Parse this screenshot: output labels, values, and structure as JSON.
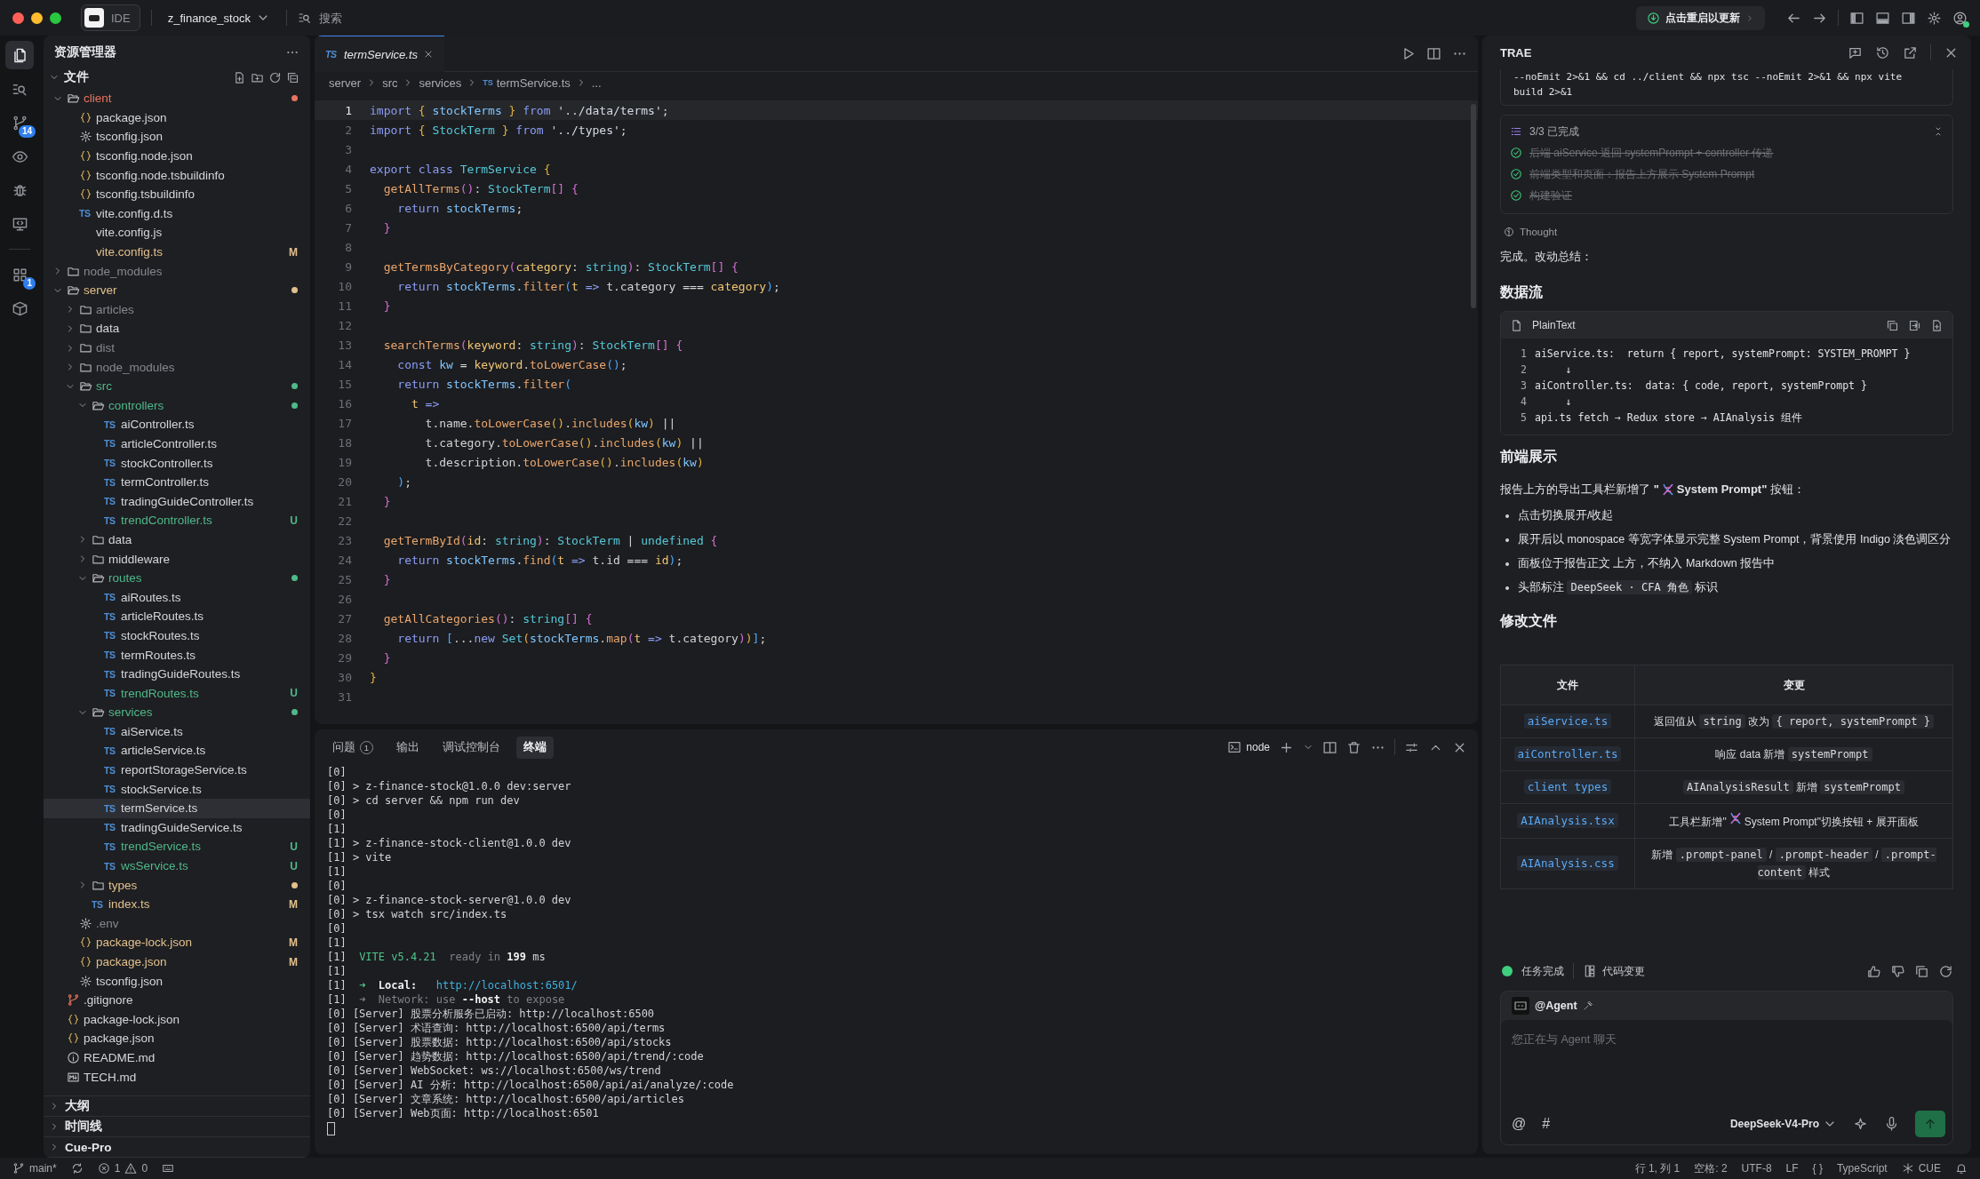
{
  "title_bar": {
    "app_label": "IDE",
    "project": "z_finance_stock",
    "search_placeholder": "搜索",
    "update_button": "点击重启以更新"
  },
  "activity_bar": [
    {
      "selected": true
    },
    {
      "selected": false
    },
    {
      "selected": false,
      "badge": "14"
    },
    {
      "selected": false
    },
    {
      "selected": false
    },
    {
      "selected": false
    },
    {
      "selected": false,
      "badge": "1"
    },
    {
      "selected": false
    }
  ],
  "explorer": {
    "title": "资源管理器",
    "section": "文件",
    "tree": [
      {
        "name": "client",
        "kind": "folder",
        "color": "#e8735f",
        "dot": true,
        "expanded": true,
        "selected": false,
        "children": [
          {
            "name": "package.json",
            "kind": "json",
            "color": "#d4d6da",
            "selected": false
          },
          {
            "name": "tsconfig.json",
            "kind": "gear",
            "color": "#d4d6da",
            "selected": false
          },
          {
            "name": "tsconfig.node.json",
            "kind": "json",
            "color": "#d4d6da",
            "selected": false
          },
          {
            "name": "tsconfig.node.tsbuildinfo",
            "kind": "json",
            "color": "#d4d6da",
            "selected": false
          },
          {
            "name": "tsconfig.tsbuildinfo",
            "kind": "json",
            "color": "#d4d6da",
            "selected": false
          },
          {
            "name": "vite.config.d.ts",
            "kind": "ts",
            "icon_label": "TS",
            "color": "#d4d6da",
            "selected": false
          },
          {
            "name": "vite.config.js",
            "kind": "plain",
            "color": "#d4d6da",
            "selected": false
          },
          {
            "name": "vite.config.ts",
            "kind": "plain",
            "color": "#e2c08d",
            "badge": "M",
            "selected": false
          }
        ]
      },
      {
        "name": "node_modules",
        "kind": "folder",
        "color": "#85888f",
        "dot": false,
        "expanded": false,
        "selected": false
      },
      {
        "name": "server",
        "kind": "folder",
        "color": "#e2c08d",
        "dot": true,
        "expanded": true,
        "selected": false,
        "children": [
          {
            "name": "articles",
            "kind": "folder",
            "color": "#85888f",
            "dot": false,
            "expanded": false,
            "selected": false
          },
          {
            "name": "data",
            "kind": "folder",
            "color": "#d4d6da",
            "dot": false,
            "expanded": false,
            "selected": false
          },
          {
            "name": "dist",
            "kind": "folder",
            "color": "#85888f",
            "dot": false,
            "expanded": false,
            "selected": false
          },
          {
            "name": "node_modules",
            "kind": "folder",
            "color": "#85888f",
            "dot": false,
            "expanded": false,
            "selected": false
          },
          {
            "name": "src",
            "kind": "folder",
            "color": "#4fb98a",
            "dot": true,
            "expanded": true,
            "selected": false,
            "children": [
              {
                "name": "controllers",
                "kind": "folder",
                "color": "#4fb98a",
                "dot": true,
                "expanded": true,
                "selected": false,
                "children": [
                  {
                    "name": "aiController.ts",
                    "kind": "ts",
                    "icon_label": "TS",
                    "color": "#d4d6da",
                    "selected": false
                  },
                  {
                    "name": "articleController.ts",
                    "kind": "ts",
                    "icon_label": "TS",
                    "color": "#d4d6da",
                    "selected": false
                  },
                  {
                    "name": "stockController.ts",
                    "kind": "ts",
                    "icon_label": "TS",
                    "color": "#d4d6da",
                    "selected": false
                  },
                  {
                    "name": "termController.ts",
                    "kind": "ts",
                    "icon_label": "TS",
                    "color": "#d4d6da",
                    "selected": false
                  },
                  {
                    "name": "tradingGuideController.ts",
                    "kind": "ts",
                    "icon_label": "TS",
                    "color": "#d4d6da",
                    "selected": false
                  },
                  {
                    "name": "trendController.ts",
                    "kind": "ts",
                    "icon_label": "TS",
                    "color": "#4fb98a",
                    "badge": "U",
                    "selected": false
                  }
                ]
              },
              {
                "name": "data",
                "kind": "folder",
                "color": "#d4d6da",
                "dot": false,
                "expanded": false,
                "selected": false
              },
              {
                "name": "middleware",
                "kind": "folder",
                "color": "#d4d6da",
                "dot": false,
                "expanded": false,
                "selected": false
              },
              {
                "name": "routes",
                "kind": "folder",
                "color": "#4fb98a",
                "dot": true,
                "expanded": true,
                "selected": false,
                "children": [
                  {
                    "name": "aiRoutes.ts",
                    "kind": "ts",
                    "icon_label": "TS",
                    "color": "#d4d6da",
                    "selected": false
                  },
                  {
                    "name": "articleRoutes.ts",
                    "kind": "ts",
                    "icon_label": "TS",
                    "color": "#d4d6da",
                    "selected": false
                  },
                  {
                    "name": "stockRoutes.ts",
                    "kind": "ts",
                    "icon_label": "TS",
                    "color": "#d4d6da",
                    "selected": false
                  },
                  {
                    "name": "termRoutes.ts",
                    "kind": "ts",
                    "icon_label": "TS",
                    "color": "#d4d6da",
                    "selected": false
                  },
                  {
                    "name": "tradingGuideRoutes.ts",
                    "kind": "ts",
                    "icon_label": "TS",
                    "color": "#d4d6da",
                    "selected": false
                  },
                  {
                    "name": "trendRoutes.ts",
                    "kind": "ts",
                    "icon_label": "TS",
                    "color": "#4fb98a",
                    "badge": "U",
                    "selected": false
                  }
                ]
              },
              {
                "name": "services",
                "kind": "folder",
                "color": "#4fb98a",
                "dot": true,
                "expanded": true,
                "selected": false,
                "children": [
                  {
                    "name": "aiService.ts",
                    "kind": "ts",
                    "icon_label": "TS",
                    "color": "#d4d6da",
                    "selected": false
                  },
                  {
                    "name": "articleService.ts",
                    "kind": "ts",
                    "icon_label": "TS",
                    "color": "#d4d6da",
                    "selected": false
                  },
                  {
                    "name": "reportStorageService.ts",
                    "kind": "ts",
                    "icon_label": "TS",
                    "color": "#d4d6da",
                    "selected": false
                  },
                  {
                    "name": "stockService.ts",
                    "kind": "ts",
                    "icon_label": "TS",
                    "color": "#d4d6da",
                    "selected": false
                  },
                  {
                    "name": "termService.ts",
                    "kind": "ts",
                    "icon_label": "TS",
                    "color": "#d4d6da",
                    "selected": true
                  },
                  {
                    "name": "tradingGuideService.ts",
                    "kind": "ts",
                    "icon_label": "TS",
                    "color": "#d4d6da",
                    "selected": false
                  },
                  {
                    "name": "trendService.ts",
                    "kind": "ts",
                    "icon_label": "TS",
                    "color": "#4fb98a",
                    "badge": "U",
                    "selected": false
                  },
                  {
                    "name": "wsService.ts",
                    "kind": "ts",
                    "icon_label": "TS",
                    "color": "#4fb98a",
                    "badge": "U",
                    "selected": false
                  }
                ]
              },
              {
                "name": "types",
                "kind": "folder",
                "color": "#e2c08d",
                "dot": true,
                "expanded": false,
                "selected": false
              },
              {
                "name": "index.ts",
                "kind": "ts",
                "icon_label": "TS",
                "color": "#e2c08d",
                "badge": "M",
                "selected": false
              }
            ]
          },
          {
            "name": ".env",
            "kind": "gear",
            "color": "#85888f",
            "selected": false
          },
          {
            "name": "package-lock.json",
            "kind": "json",
            "color": "#e2c08d",
            "badge": "M",
            "selected": false
          },
          {
            "name": "package.json",
            "kind": "json",
            "color": "#e2c08d",
            "badge": "M",
            "selected": false
          },
          {
            "name": "tsconfig.json",
            "kind": "gear",
            "color": "#d4d6da",
            "selected": false
          }
        ]
      },
      {
        "name": ".gitignore",
        "kind": "git",
        "color": "#d4d6da",
        "selected": false
      },
      {
        "name": "package-lock.json",
        "kind": "json",
        "color": "#d4d6da",
        "selected": false
      },
      {
        "name": "package.json",
        "kind": "json",
        "color": "#d4d6da",
        "selected": false
      },
      {
        "name": "README.md",
        "kind": "info",
        "color": "#d4d6da",
        "selected": false
      },
      {
        "name": "TECH.md",
        "kind": "md",
        "color": "#d4d6da",
        "selected": false
      }
    ],
    "panels": [
      "大纲",
      "时间线",
      "Cue-Pro"
    ]
  },
  "editor": {
    "tabs": [
      {
        "label": "termService.ts",
        "icon_label": "TS",
        "selected": true
      }
    ],
    "breadcrumb": [
      {
        "label": "server"
      },
      {
        "label": "src"
      },
      {
        "label": "services"
      },
      {
        "label": "termService.ts",
        "icon_label": "TS"
      },
      {
        "label": "..."
      }
    ],
    "lines": [
      {
        "number": "1",
        "current": true,
        "tokens": [
          {
            "text": "import",
            "kind": "keyword"
          },
          {
            "text": " {",
            "kind": "brace"
          },
          {
            "text": " stockTerms ",
            "kind": "variable"
          },
          {
            "text": "}",
            "kind": "brace"
          },
          {
            "text": " from",
            "kind": "keyword"
          },
          {
            "text": " '../data/terms'",
            "kind": "string"
          },
          {
            "text": ";",
            "kind": "plain"
          }
        ]
      },
      {
        "number": "2",
        "current": false,
        "tokens": [
          {
            "text": "import",
            "kind": "keyword"
          },
          {
            "text": " {",
            "kind": "brace"
          },
          {
            "text": " StockTerm ",
            "kind": "type"
          },
          {
            "text": "}",
            "kind": "brace"
          },
          {
            "text": " from",
            "kind": "keyword"
          },
          {
            "text": " '../types'",
            "kind": "string"
          },
          {
            "text": ";",
            "kind": "plain"
          }
        ]
      },
      {
        "number": "3",
        "current": false
      },
      {
        "number": "4",
        "current": false,
        "tokens": [
          {
            "text": "export class",
            "kind": "keyword"
          },
          {
            "text": " TermService",
            "kind": "type"
          },
          {
            "text": " {",
            "kind": "brace"
          }
        ]
      },
      {
        "number": "5",
        "current": false,
        "tokens": [
          {
            "text": "  getAllTerms",
            "kind": "function"
          },
          {
            "text": "()",
            "kind": "paren"
          },
          {
            "text": ": ",
            "kind": "plain"
          },
          {
            "text": "StockTerm",
            "kind": "type"
          },
          {
            "text": "[]",
            "kind": "paren"
          },
          {
            "text": " {",
            "kind": "paren"
          }
        ]
      },
      {
        "number": "6",
        "current": false,
        "tokens": [
          {
            "text": "    return",
            "kind": "keyword"
          },
          {
            "text": " stockTerms",
            "kind": "variable"
          },
          {
            "text": ";",
            "kind": "plain"
          }
        ]
      },
      {
        "number": "7",
        "current": false,
        "tokens": [
          {
            "text": "  }",
            "kind": "paren"
          }
        ]
      },
      {
        "number": "8",
        "current": false
      },
      {
        "number": "9",
        "current": false,
        "tokens": [
          {
            "text": "  getTermsByCategory",
            "kind": "function"
          },
          {
            "text": "(",
            "kind": "paren"
          },
          {
            "text": "category",
            "kind": "parameter"
          },
          {
            "text": ": ",
            "kind": "plain"
          },
          {
            "text": "string",
            "kind": "type"
          },
          {
            "text": ")",
            "kind": "paren"
          },
          {
            "text": ": ",
            "kind": "plain"
          },
          {
            "text": "StockTerm",
            "kind": "type"
          },
          {
            "text": "[]",
            "kind": "paren"
          },
          {
            "text": " {",
            "kind": "paren"
          }
        ]
      },
      {
        "number": "10",
        "current": false,
        "tokens": [
          {
            "text": "    return",
            "kind": "keyword"
          },
          {
            "text": " stockTerms",
            "kind": "variable"
          },
          {
            "text": ".",
            "kind": "plain"
          },
          {
            "text": "filter",
            "kind": "function"
          },
          {
            "text": "(",
            "kind": "bracket"
          },
          {
            "text": "t",
            "kind": "parameter"
          },
          {
            "text": " => ",
            "kind": "keyword"
          },
          {
            "text": "t.category === ",
            "kind": "plain"
          },
          {
            "text": "category",
            "kind": "parameter"
          },
          {
            "text": ")",
            "kind": "bracket"
          },
          {
            "text": ";",
            "kind": "plain"
          }
        ]
      },
      {
        "number": "11",
        "current": false,
        "tokens": [
          {
            "text": "  }",
            "kind": "paren"
          }
        ]
      },
      {
        "number": "12",
        "current": false
      },
      {
        "number": "13",
        "current": false,
        "tokens": [
          {
            "text": "  searchTerms",
            "kind": "function"
          },
          {
            "text": "(",
            "kind": "paren"
          },
          {
            "text": "keyword",
            "kind": "parameter"
          },
          {
            "text": ": ",
            "kind": "plain"
          },
          {
            "text": "string",
            "kind": "type"
          },
          {
            "text": ")",
            "kind": "paren"
          },
          {
            "text": ": ",
            "kind": "plain"
          },
          {
            "text": "StockTerm",
            "kind": "type"
          },
          {
            "text": "[]",
            "kind": "paren"
          },
          {
            "text": " {",
            "kind": "paren"
          }
        ]
      },
      {
        "number": "14",
        "current": false,
        "tokens": [
          {
            "text": "    const",
            "kind": "keyword"
          },
          {
            "text": " kw",
            "kind": "variable"
          },
          {
            "text": " = ",
            "kind": "plain"
          },
          {
            "text": "keyword",
            "kind": "parameter"
          },
          {
            "text": ".",
            "kind": "plain"
          },
          {
            "text": "toLowerCase",
            "kind": "function"
          },
          {
            "text": "()",
            "kind": "bracket"
          },
          {
            "text": ";",
            "kind": "plain"
          }
        ]
      },
      {
        "number": "15",
        "current": false,
        "tokens": [
          {
            "text": "    return",
            "kind": "keyword"
          },
          {
            "text": " stockTerms",
            "kind": "variable"
          },
          {
            "text": ".",
            "kind": "plain"
          },
          {
            "text": "filter",
            "kind": "function"
          },
          {
            "text": "(",
            "kind": "bracket"
          }
        ]
      },
      {
        "number": "16",
        "current": false,
        "tokens": [
          {
            "text": "      t",
            "kind": "parameter"
          },
          {
            "text": " =>",
            "kind": "keyword"
          }
        ]
      },
      {
        "number": "17",
        "current": false,
        "tokens": [
          {
            "text": "        t.name.",
            "kind": "plain"
          },
          {
            "text": "toLowerCase",
            "kind": "function"
          },
          {
            "text": "()",
            "kind": "brace"
          },
          {
            "text": ".",
            "kind": "plain"
          },
          {
            "text": "includes",
            "kind": "function"
          },
          {
            "text": "(",
            "kind": "brace"
          },
          {
            "text": "kw",
            "kind": "variable"
          },
          {
            "text": ")",
            "kind": "brace"
          },
          {
            "text": " ||",
            "kind": "plain"
          }
        ]
      },
      {
        "number": "18",
        "current": false,
        "tokens": [
          {
            "text": "        t.category.",
            "kind": "plain"
          },
          {
            "text": "toLowerCase",
            "kind": "function"
          },
          {
            "text": "()",
            "kind": "brace"
          },
          {
            "text": ".",
            "kind": "plain"
          },
          {
            "text": "includes",
            "kind": "function"
          },
          {
            "text": "(",
            "kind": "brace"
          },
          {
            "text": "kw",
            "kind": "variable"
          },
          {
            "text": ")",
            "kind": "brace"
          },
          {
            "text": " ||",
            "kind": "plain"
          }
        ]
      },
      {
        "number": "19",
        "current": false,
        "tokens": [
          {
            "text": "        t.description.",
            "kind": "plain"
          },
          {
            "text": "toLowerCase",
            "kind": "function"
          },
          {
            "text": "()",
            "kind": "brace"
          },
          {
            "text": ".",
            "kind": "plain"
          },
          {
            "text": "includes",
            "kind": "function"
          },
          {
            "text": "(",
            "kind": "brace"
          },
          {
            "text": "kw",
            "kind": "variable"
          },
          {
            "text": ")",
            "kind": "brace"
          }
        ]
      },
      {
        "number": "20",
        "current": false,
        "tokens": [
          {
            "text": "    )",
            "kind": "bracket"
          },
          {
            "text": ";",
            "kind": "plain"
          }
        ]
      },
      {
        "number": "21",
        "current": false,
        "tokens": [
          {
            "text": "  }",
            "kind": "paren"
          }
        ]
      },
      {
        "number": "22",
        "current": false
      },
      {
        "number": "23",
        "current": false,
        "tokens": [
          {
            "text": "  getTermById",
            "kind": "function"
          },
          {
            "text": "(",
            "kind": "paren"
          },
          {
            "text": "id",
            "kind": "parameter"
          },
          {
            "text": ": ",
            "kind": "plain"
          },
          {
            "text": "string",
            "kind": "type"
          },
          {
            "text": ")",
            "kind": "paren"
          },
          {
            "text": ": ",
            "kind": "plain"
          },
          {
            "text": "StockTerm",
            "kind": "type"
          },
          {
            "text": " | ",
            "kind": "plain"
          },
          {
            "text": "undefined",
            "kind": "type"
          },
          {
            "text": " {",
            "kind": "paren"
          }
        ]
      },
      {
        "number": "24",
        "current": false,
        "tokens": [
          {
            "text": "    return",
            "kind": "keyword"
          },
          {
            "text": " stockTerms",
            "kind": "variable"
          },
          {
            "text": ".",
            "kind": "plain"
          },
          {
            "text": "find",
            "kind": "function"
          },
          {
            "text": "(",
            "kind": "bracket"
          },
          {
            "text": "t",
            "kind": "parameter"
          },
          {
            "text": " => ",
            "kind": "keyword"
          },
          {
            "text": "t.id === ",
            "kind": "plain"
          },
          {
            "text": "id",
            "kind": "parameter"
          },
          {
            "text": ")",
            "kind": "bracket"
          },
          {
            "text": ";",
            "kind": "plain"
          }
        ]
      },
      {
        "number": "25",
        "current": false,
        "tokens": [
          {
            "text": "  }",
            "kind": "paren"
          }
        ]
      },
      {
        "number": "26",
        "current": false
      },
      {
        "number": "27",
        "current": false,
        "tokens": [
          {
            "text": "  getAllCategories",
            "kind": "function"
          },
          {
            "text": "()",
            "kind": "paren"
          },
          {
            "text": ": ",
            "kind": "plain"
          },
          {
            "text": "string",
            "kind": "type"
          },
          {
            "text": "[]",
            "kind": "paren"
          },
          {
            "text": " {",
            "kind": "paren"
          }
        ]
      },
      {
        "number": "28",
        "current": false,
        "tokens": [
          {
            "text": "    return",
            "kind": "keyword"
          },
          {
            "text": " [",
            "kind": "bracket"
          },
          {
            "text": "...",
            "kind": "plain"
          },
          {
            "text": "new",
            "kind": "keyword"
          },
          {
            "text": " Set",
            "kind": "type"
          },
          {
            "text": "(",
            "kind": "brace"
          },
          {
            "text": "stockTerms",
            "kind": "variable"
          },
          {
            "text": ".",
            "kind": "plain"
          },
          {
            "text": "map",
            "kind": "function"
          },
          {
            "text": "(",
            "kind": "paren"
          },
          {
            "text": "t",
            "kind": "parameter"
          },
          {
            "text": " => ",
            "kind": "keyword"
          },
          {
            "text": "t.category",
            "kind": "plain"
          },
          {
            "text": ")",
            "kind": "paren"
          },
          {
            "text": ")",
            "kind": "brace"
          },
          {
            "text": "]",
            "kind": "bracket"
          },
          {
            "text": ";",
            "kind": "plain"
          }
        ]
      },
      {
        "number": "29",
        "current": false,
        "tokens": [
          {
            "text": "  }",
            "kind": "paren"
          }
        ]
      },
      {
        "number": "30",
        "current": false,
        "tokens": [
          {
            "text": "}",
            "kind": "brace"
          }
        ]
      },
      {
        "number": "31",
        "current": false
      }
    ]
  },
  "panel": {
    "tabs": [
      {
        "label": "问题",
        "badge": "1",
        "selected": false
      },
      {
        "label": "输出",
        "selected": false
      },
      {
        "label": "调试控制台",
        "selected": false
      },
      {
        "label": "终端",
        "selected": true
      }
    ],
    "shell": "node",
    "lines": [
      {
        "segments": [
          {
            "text": "[0]",
            "kind": "plain"
          }
        ]
      },
      {
        "segments": [
          {
            "text": "[0] > z-finance-stock@1.0.0 dev:server",
            "kind": "plain"
          }
        ]
      },
      {
        "segments": [
          {
            "text": "[0] > cd server && npm run dev",
            "kind": "plain"
          }
        ]
      },
      {
        "segments": [
          {
            "text": "[0]",
            "kind": "plain"
          }
        ]
      },
      {
        "segments": [
          {
            "text": "[1]",
            "kind": "plain"
          }
        ]
      },
      {
        "segments": [
          {
            "text": "[1] > z-finance-stock-client@1.0.0 dev",
            "kind": "plain"
          }
        ]
      },
      {
        "segments": [
          {
            "text": "[1] > vite",
            "kind": "plain"
          }
        ]
      },
      {
        "segments": [
          {
            "text": "[1]",
            "kind": "plain"
          }
        ]
      },
      {
        "segments": [
          {
            "text": "[0]",
            "kind": "plain"
          }
        ]
      },
      {
        "segments": [
          {
            "text": "[0] > z-finance-stock-server@1.0.0 dev",
            "kind": "plain"
          }
        ]
      },
      {
        "segments": [
          {
            "text": "[0] > tsx watch src/index.ts",
            "kind": "plain"
          }
        ]
      },
      {
        "segments": [
          {
            "text": "[0]",
            "kind": "plain"
          }
        ]
      },
      {
        "segments": [
          {
            "text": "[1]",
            "kind": "plain"
          }
        ]
      },
      {
        "segments": [
          {
            "text": "[1]  ",
            "kind": "plain"
          },
          {
            "text": "VITE v5.4.21",
            "kind": "accent"
          },
          {
            "text": "  ready in ",
            "kind": "muted"
          },
          {
            "text": "199",
            "kind": "strong"
          },
          {
            "text": " ms",
            "kind": "plain"
          }
        ]
      },
      {
        "segments": [
          {
            "text": "[1]",
            "kind": "plain"
          }
        ]
      },
      {
        "segments": [
          {
            "text": "[1]  ",
            "kind": "plain"
          },
          {
            "text": "➜",
            "kind": "accent"
          },
          {
            "text": "  Local:   ",
            "kind": "strong"
          },
          {
            "text": "http://localhost:6501/",
            "kind": "link"
          }
        ]
      },
      {
        "segments": [
          {
            "text": "[1]  ",
            "kind": "plain"
          },
          {
            "text": "➜  Network: use ",
            "kind": "muted"
          },
          {
            "text": "--host",
            "kind": "strong"
          },
          {
            "text": " to expose",
            "kind": "muted"
          }
        ]
      },
      {
        "segments": [
          {
            "text": "[0] [Server] 股票分析服务已启动: http://localhost:6500",
            "kind": "plain"
          }
        ]
      },
      {
        "segments": [
          {
            "text": "[0] [Server] 术语查询: http://localhost:6500/api/terms",
            "kind": "plain"
          }
        ]
      },
      {
        "segments": [
          {
            "text": "[0] [Server] 股票数据: http://localhost:6500/api/stocks",
            "kind": "plain"
          }
        ]
      },
      {
        "segments": [
          {
            "text": "[0] [Server] 趋势数据: http://localhost:6500/api/trend/:code",
            "kind": "plain"
          }
        ]
      },
      {
        "segments": [
          {
            "text": "[0] [Server] WebSocket: ws://localhost:6500/ws/trend",
            "kind": "plain"
          }
        ]
      },
      {
        "segments": [
          {
            "text": "[0] [Server] AI 分析: http://localhost:6500/api/ai/analyze/:code",
            "kind": "plain"
          }
        ]
      },
      {
        "segments": [
          {
            "text": "[0] [Server] 文章系统: http://localhost:6500/api/articles",
            "kind": "plain"
          }
        ]
      },
      {
        "segments": [
          {
            "text": "[0] [Server] Web页面: http://localhost:6501",
            "kind": "plain"
          }
        ]
      }
    ]
  },
  "assistant": {
    "title": "TRAE",
    "command_lines": [
      "--noEmit 2>&1 && cd ../client && npx tsc --noEmit 2>&1 && npx vite",
      "build 2>&1"
    ],
    "todo": {
      "summary": "3/3 已完成",
      "items": [
        {
          "text": "后端 aiService 返回 systemPrompt + controller 传递",
          "done": true
        },
        {
          "text": "前端类型和页面：报告上方展示 System Prompt",
          "done": true
        },
        {
          "text": "构建验证",
          "done": true
        }
      ]
    },
    "thought": "Thought",
    "blocks": [
      {
        "kind": "paragraph",
        "segments": [
          {
            "kind": "text",
            "text": "完成。改动总结："
          }
        ]
      },
      {
        "kind": "heading",
        "text": "数据流"
      },
      {
        "kind": "code",
        "language": "PlainText",
        "lines": [
          {
            "number": "1",
            "text": "aiService.ts:  return { report, systemPrompt: SYSTEM_PROMPT }"
          },
          {
            "number": "2",
            "text": "     ↓"
          },
          {
            "number": "3",
            "text": "aiController.ts:  data: { code, report, systemPrompt }"
          },
          {
            "number": "4",
            "text": "     ↓"
          },
          {
            "number": "5",
            "text": "api.ts fetch → Redux store → AIAnalysis 组件"
          }
        ]
      },
      {
        "kind": "heading",
        "text": "前端展示"
      },
      {
        "kind": "paragraph",
        "segments": [
          {
            "kind": "text",
            "text": "报告上方的导出工具栏新增了 **\"**"
          },
          {
            "kind": "icon"
          },
          {
            "kind": "text",
            "text": " **System Prompt\"** 按钮："
          }
        ]
      },
      {
        "kind": "bullets",
        "items": [
          {
            "segments": [
              {
                "kind": "text",
                "text": "点击切换展开/收起"
              }
            ]
          },
          {
            "segments": [
              {
                "kind": "text",
                "text": "展开后以 monospace 等宽字体显示完整 System Prompt，背景使用 Indigo 淡色调区分"
              }
            ]
          },
          {
            "segments": [
              {
                "kind": "text",
                "text": "面板位于报告正文 上方，不纳入 Markdown 报告中"
              }
            ]
          },
          {
            "segments": [
              {
                "kind": "text",
                "text": "头部标注 "
              },
              {
                "kind": "code",
                "text": "DeepSeek · CFA 角色"
              },
              {
                "kind": "text",
                "text": " 标识"
              }
            ]
          }
        ]
      },
      {
        "kind": "heading",
        "text": "修改文件"
      },
      {
        "kind": "table",
        "columns": [
          "文件",
          "变更"
        ],
        "rows": [
          {
            "file": "aiService.ts",
            "change": [
              {
                "kind": "text",
                "text": "返回值从 "
              },
              {
                "kind": "code",
                "text": "string"
              },
              {
                "kind": "text",
                "text": " 改为 "
              },
              {
                "kind": "code",
                "text": "{ report, systemPrompt }"
              }
            ]
          },
          {
            "file": "aiController.ts",
            "change": [
              {
                "kind": "text",
                "text": "响应 data 新增 "
              },
              {
                "kind": "code",
                "text": "systemPrompt"
              }
            ]
          },
          {
            "file": "client types",
            "change": [
              {
                "kind": "code",
                "text": "AIAnalysisResult"
              },
              {
                "kind": "text",
                "text": " 新增 "
              },
              {
                "kind": "code",
                "text": "systemPrompt"
              }
            ]
          },
          {
            "file": "AIAnalysis.tsx",
            "change": [
              {
                "kind": "text",
                "text": "工具栏新增\""
              },
              {
                "kind": "icon"
              },
              {
                "kind": "text",
                "text": " System Prompt\"切换按钮 + 展开面板"
              }
            ]
          },
          {
            "file": "AIAnalysis.css",
            "change": [
              {
                "kind": "text",
                "text": "新增 "
              },
              {
                "kind": "code",
                "text": ".prompt-panel"
              },
              {
                "kind": "text",
                "text": " / "
              },
              {
                "kind": "code",
                "text": ".prompt-header"
              },
              {
                "kind": "text",
                "text": " / "
              },
              {
                "kind": "code",
                "text": ".prompt-content"
              },
              {
                "kind": "text",
                "text": " 样式"
              }
            ]
          }
        ]
      }
    ],
    "footer": {
      "status": "任务完成",
      "changes": "代码变更"
    },
    "chat": {
      "agent": "@Agent",
      "placeholder": "您正在与 Agent 聊天",
      "at": "@",
      "hash": "#",
      "model": "DeepSeek-V4-Pro"
    }
  },
  "status_bar": {
    "branch": "main*",
    "errors": "1",
    "warnings": "0",
    "position": "行 1, 列 1",
    "indent": "空格: 2",
    "encoding": "UTF-8",
    "eol": "LF",
    "braces": "{ }",
    "language": "TypeScript",
    "plugin": "CUE"
  }
}
